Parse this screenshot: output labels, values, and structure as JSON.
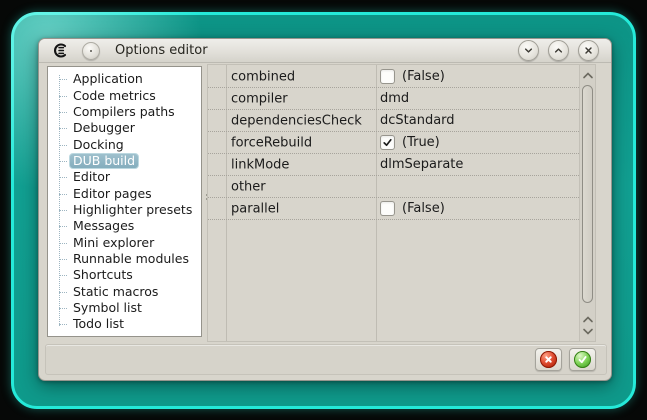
{
  "window": {
    "title": "Options editor",
    "buttons": [
      {
        "name": "shade-button",
        "icon": "chevron-down-icon"
      },
      {
        "name": "maximize-button",
        "icon": "chevron-up-icon"
      },
      {
        "name": "close-button",
        "icon": "close-icon"
      }
    ]
  },
  "sidebar": {
    "items": [
      "Application",
      "Code metrics",
      "Compilers paths",
      "Debugger",
      "Docking",
      "DUB build",
      "Editor",
      "Editor pages",
      "Highlighter presets",
      "Messages",
      "Mini explorer",
      "Runnable modules",
      "Shortcuts",
      "Static macros",
      "Symbol list",
      "Todo list"
    ],
    "selected": "DUB build"
  },
  "properties": {
    "rows": [
      {
        "name": "combined",
        "kind": "bool",
        "checked": false,
        "display": "(False)"
      },
      {
        "name": "compiler",
        "kind": "text",
        "display": "dmd"
      },
      {
        "name": "dependenciesCheck",
        "kind": "text",
        "display": "dcStandard"
      },
      {
        "name": "forceRebuild",
        "kind": "bool",
        "checked": true,
        "display": "(True)"
      },
      {
        "name": "linkMode",
        "kind": "text",
        "display": "dlmSeparate"
      },
      {
        "name": "other",
        "kind": "empty",
        "display": ""
      },
      {
        "name": "parallel",
        "kind": "bool",
        "checked": false,
        "display": "(False)"
      }
    ]
  },
  "footer": {
    "buttons": [
      {
        "name": "cancel-button",
        "icon": "cancel-cross-icon",
        "color": "#c9300d"
      },
      {
        "name": "accept-button",
        "icon": "accept-check-icon",
        "color": "#4fae27"
      }
    ]
  },
  "icons": [
    "coedit-logo-icon",
    "window-menu-ball-icon",
    "chevron-down-icon",
    "chevron-up-icon",
    "close-icon",
    "checkbox-check-icon",
    "scroll-up-icon",
    "scroll-down-icon",
    "splitter-grip-icon",
    "cancel-cross-icon",
    "accept-check-icon"
  ],
  "colors": {
    "desktop_teal": "#11a092",
    "glow_cyan": "#25ead9",
    "window_bg": "#d8d5cc",
    "selection_blue": "#8fb6c5",
    "cancel_red": "#c9300d",
    "accept_green": "#4fae27"
  }
}
